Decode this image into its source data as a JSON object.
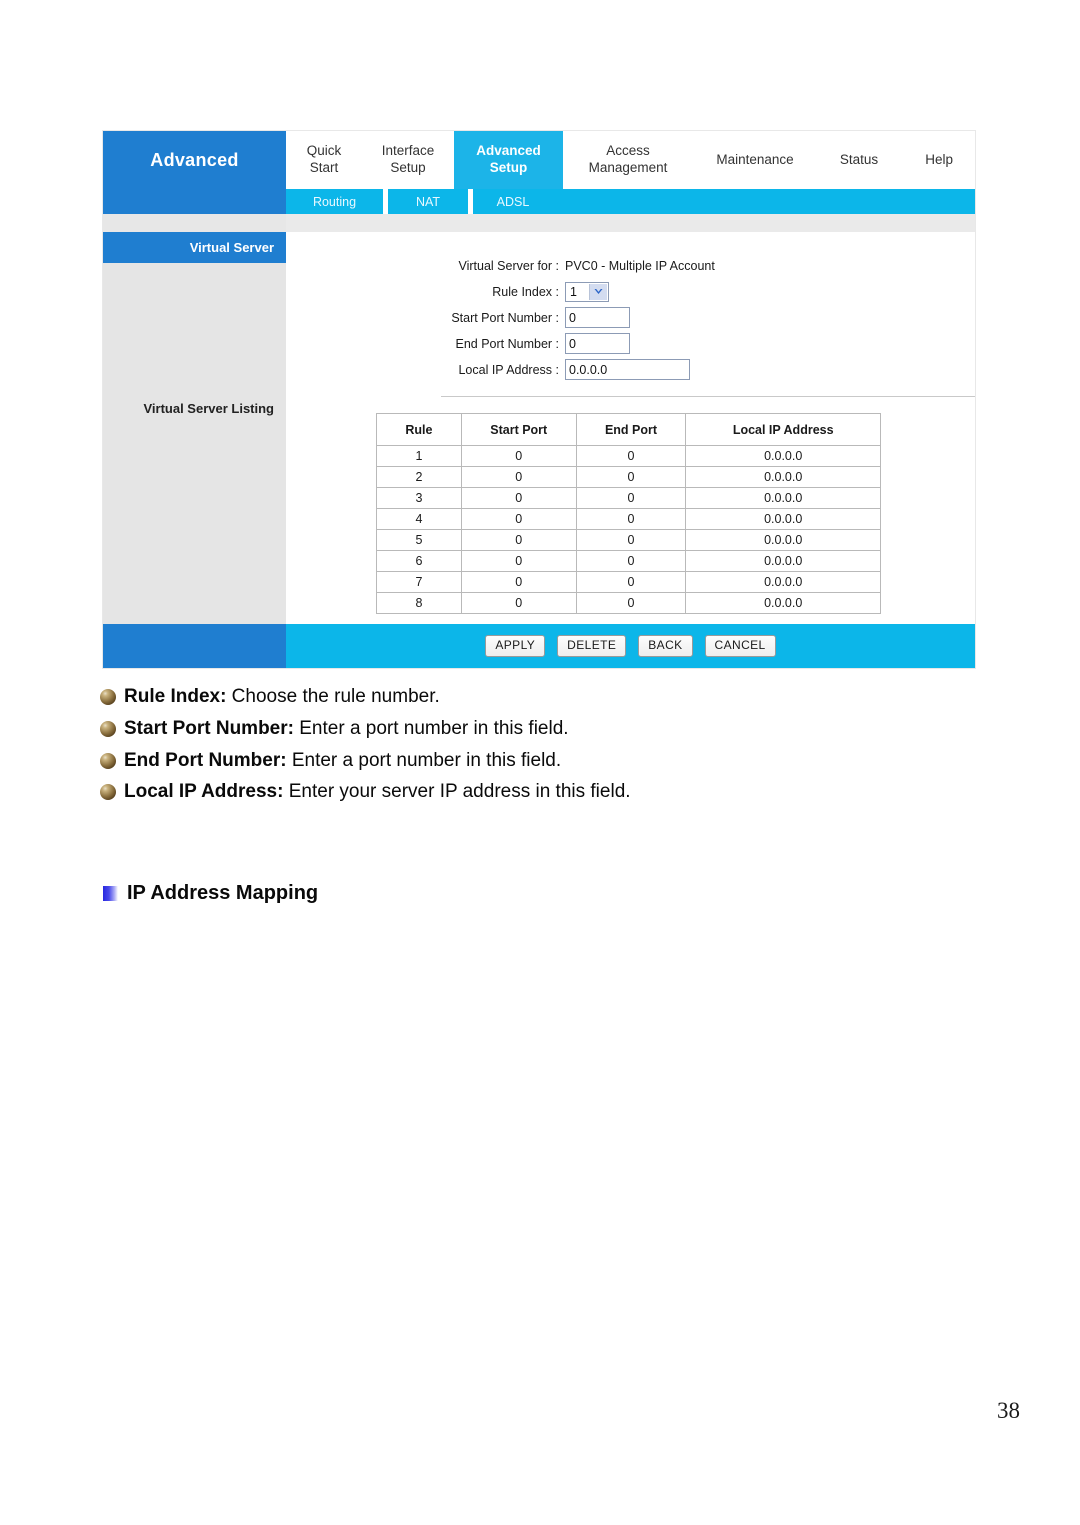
{
  "router_ui": {
    "brand_label": "Advanced",
    "main_tabs": [
      {
        "label": "Quick\nStart",
        "active": false
      },
      {
        "label": "Interface\nSetup",
        "active": false
      },
      {
        "label": "Advanced\nSetup",
        "active": true
      },
      {
        "label": "Access\nManagement",
        "active": false
      },
      {
        "label": "Maintenance",
        "active": false
      },
      {
        "label": "Status",
        "active": false
      },
      {
        "label": "Help",
        "active": false
      }
    ],
    "sub_tabs": [
      {
        "label": "Routing"
      },
      {
        "label": "NAT"
      },
      {
        "label": "ADSL"
      }
    ],
    "sidebar": {
      "active_item": "Virtual Server",
      "listing_item": "Virtual Server Listing"
    },
    "form": {
      "virtual_server_for_label": "Virtual Server for :",
      "virtual_server_for_value": "PVC0 - Multiple IP Account",
      "rule_index_label": "Rule Index :",
      "rule_index_value": "1",
      "start_port_label": "Start Port Number :",
      "start_port_value": "0",
      "end_port_label": "End Port Number :",
      "end_port_value": "0",
      "local_ip_label": "Local IP Address :",
      "local_ip_value": "0.0.0.0"
    },
    "listing_table": {
      "headers": [
        "Rule",
        "Start Port",
        "End Port",
        "Local IP Address"
      ],
      "rows": [
        [
          "1",
          "0",
          "0",
          "0.0.0.0"
        ],
        [
          "2",
          "0",
          "0",
          "0.0.0.0"
        ],
        [
          "3",
          "0",
          "0",
          "0.0.0.0"
        ],
        [
          "4",
          "0",
          "0",
          "0.0.0.0"
        ],
        [
          "5",
          "0",
          "0",
          "0.0.0.0"
        ],
        [
          "6",
          "0",
          "0",
          "0.0.0.0"
        ],
        [
          "7",
          "0",
          "0",
          "0.0.0.0"
        ],
        [
          "8",
          "0",
          "0",
          "0.0.0.0"
        ]
      ]
    },
    "buttons": [
      {
        "label": "APPLY"
      },
      {
        "label": "DELETE"
      },
      {
        "label": "BACK"
      },
      {
        "label": "CANCEL"
      }
    ],
    "colors": {
      "brand_blue": "#1f7ed0",
      "tab_cyan": "#1cb4e8",
      "bar_cyan": "#0cb6e9",
      "sidebar_grey": "#e5e5e5"
    }
  },
  "doc": {
    "bullets": [
      {
        "term": "Rule Index:",
        "desc": " Choose the rule number."
      },
      {
        "term": "Start Port Number:",
        "desc": " Enter a port number in this field."
      },
      {
        "term": "End Port Number:",
        "desc": " Enter a port number in this field."
      },
      {
        "term": "Local IP Address:",
        "desc": " Enter your server IP address in this field."
      }
    ],
    "section_heading": "IP Address Mapping",
    "page_number": "38"
  }
}
